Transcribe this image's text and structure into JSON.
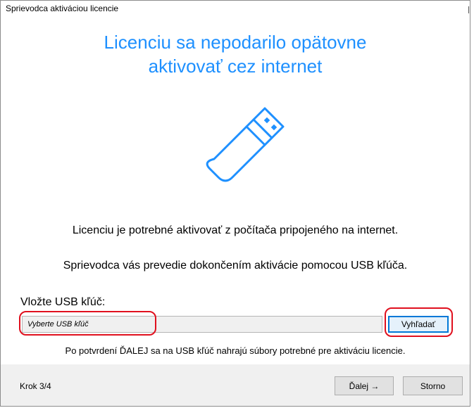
{
  "window": {
    "title": "Sprievodca aktiváciou licencie"
  },
  "heading": {
    "line1": "Licenciu sa nepodarilo opätovne",
    "line2": "aktivovať cez internet"
  },
  "icons": {
    "main": "usb-drive-icon"
  },
  "body": {
    "description1": "Licenciu je potrebné aktivovať z počítača pripojeného na internet.",
    "description2": "Sprievodca vás prevedie dokončením aktivácie pomocou USB kľúča.",
    "usb_label": "Vložte USB kľúč:",
    "usb_select_placeholder": "Vyberte USB kľúč",
    "search_button": "Vyhľadať",
    "note": "Po potvrdení ĎALEJ sa na USB kľúč nahrajú súbory potrebné pre aktiváciu licencie."
  },
  "footer": {
    "step": "Krok 3/4",
    "next_button": "Ďalej →",
    "cancel_button": "Storno"
  },
  "colors": {
    "heading": "#1e90ff",
    "highlight": "#e0101e",
    "focus_border": "#0078d7"
  }
}
